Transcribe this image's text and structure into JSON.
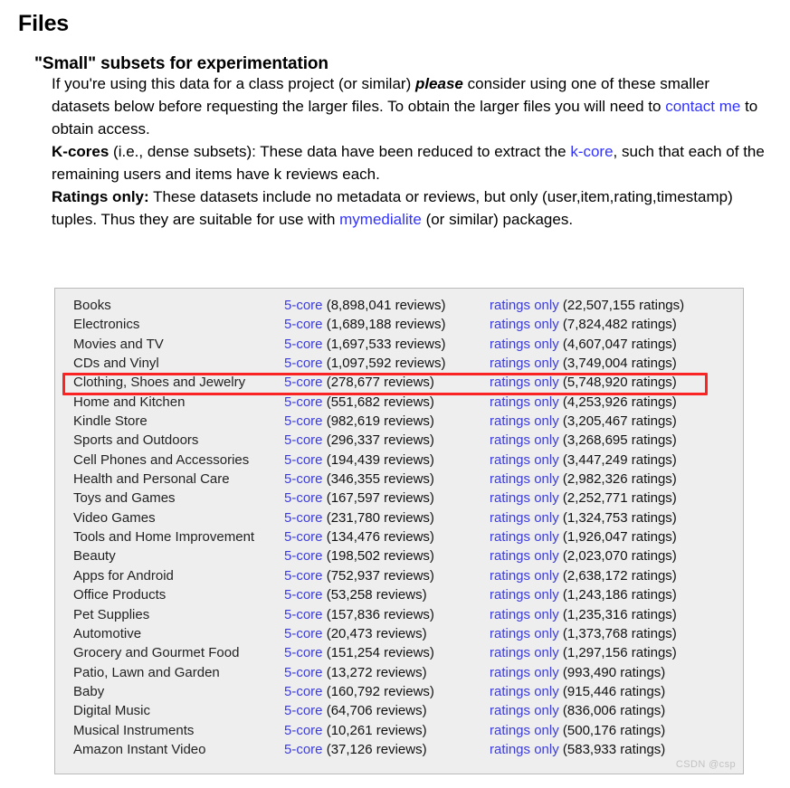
{
  "page": {
    "title": "Files",
    "subtitle": "\"Small\" subsets for experimentation",
    "watermark": "CSDN @csp"
  },
  "paragraphs": {
    "intro": {
      "part1": "If you're using this data for a class project (or similar) ",
      "emphasis": "please",
      "part2": " consider using one of these smaller datasets below before requesting the larger files. To obtain the larger files you will need to ",
      "link": "contact me",
      "part3": " to obtain access."
    },
    "kcores": {
      "lead": "K-cores",
      "part1": " (i.e., dense subsets): These data have been reduced to extract the ",
      "link": "k-core",
      "part2": ", such that each of the remaining users and items have k reviews each."
    },
    "ratings": {
      "lead": "Ratings only:",
      "part1": " These datasets include no metadata or reviews, but only (user,item,rating,timestamp) tuples. Thus they are suitable for use with ",
      "link": "mymedialite",
      "part2": " (or similar) packages."
    }
  },
  "table": {
    "core_link_label": "5-core",
    "ratings_link_label": "ratings only",
    "highlighted_row_index": 4,
    "rows": [
      {
        "name": "Books",
        "core_link": "5-core",
        "core_count": "(8,898,041 reviews)",
        "ratings_link": "ratings only",
        "ratings_count": "(22,507,155 ratings)"
      },
      {
        "name": "Electronics",
        "core_link": "5-core",
        "core_count": "(1,689,188 reviews)",
        "ratings_link": "ratings only",
        "ratings_count": "(7,824,482 ratings)"
      },
      {
        "name": "Movies and TV",
        "core_link": "5-core",
        "core_count": "(1,697,533 reviews)",
        "ratings_link": "ratings only",
        "ratings_count": "(4,607,047 ratings)"
      },
      {
        "name": "CDs and Vinyl",
        "core_link": "5-core",
        "core_count": "(1,097,592 reviews)",
        "ratings_link": "ratings only",
        "ratings_count": "(3,749,004 ratings)"
      },
      {
        "name": "Clothing, Shoes and Jewelry",
        "core_link": "5-core",
        "core_count": "(278,677 reviews)",
        "ratings_link": "ratings only",
        "ratings_count": "(5,748,920 ratings)"
      },
      {
        "name": "Home and Kitchen",
        "core_link": "5-core",
        "core_count": "(551,682 reviews)",
        "ratings_link": "ratings only",
        "ratings_count": "(4,253,926 ratings)"
      },
      {
        "name": "Kindle Store",
        "core_link": "5-core",
        "core_count": "(982,619 reviews)",
        "ratings_link": "ratings only",
        "ratings_count": "(3,205,467 ratings)"
      },
      {
        "name": "Sports and Outdoors",
        "core_link": "5-core",
        "core_count": "(296,337 reviews)",
        "ratings_link": "ratings only",
        "ratings_count": "(3,268,695 ratings)"
      },
      {
        "name": "Cell Phones and Accessories",
        "core_link": "5-core",
        "core_count": "(194,439 reviews)",
        "ratings_link": "ratings only",
        "ratings_count": "(3,447,249 ratings)"
      },
      {
        "name": "Health and Personal Care",
        "core_link": "5-core",
        "core_count": "(346,355 reviews)",
        "ratings_link": "ratings only",
        "ratings_count": "(2,982,326 ratings)"
      },
      {
        "name": "Toys and Games",
        "core_link": "5-core",
        "core_count": "(167,597 reviews)",
        "ratings_link": "ratings only",
        "ratings_count": "(2,252,771 ratings)"
      },
      {
        "name": "Video Games",
        "core_link": "5-core",
        "core_count": "(231,780 reviews)",
        "ratings_link": "ratings only",
        "ratings_count": "(1,324,753 ratings)"
      },
      {
        "name": "Tools and Home Improvement",
        "core_link": "5-core",
        "core_count": "(134,476 reviews)",
        "ratings_link": "ratings only",
        "ratings_count": "(1,926,047 ratings)"
      },
      {
        "name": "Beauty",
        "core_link": "5-core",
        "core_count": "(198,502 reviews)",
        "ratings_link": "ratings only",
        "ratings_count": "(2,023,070 ratings)"
      },
      {
        "name": "Apps for Android",
        "core_link": "5-core",
        "core_count": "(752,937 reviews)",
        "ratings_link": "ratings only",
        "ratings_count": "(2,638,172 ratings)"
      },
      {
        "name": "Office Products",
        "core_link": "5-core",
        "core_count": "(53,258 reviews)",
        "ratings_link": "ratings only",
        "ratings_count": "(1,243,186 ratings)"
      },
      {
        "name": "Pet Supplies",
        "core_link": "5-core",
        "core_count": "(157,836 reviews)",
        "ratings_link": "ratings only",
        "ratings_count": "(1,235,316 ratings)"
      },
      {
        "name": "Automotive",
        "core_link": "5-core",
        "core_count": "(20,473 reviews)",
        "ratings_link": "ratings only",
        "ratings_count": "(1,373,768 ratings)"
      },
      {
        "name": "Grocery and Gourmet Food",
        "core_link": "5-core",
        "core_count": "(151,254 reviews)",
        "ratings_link": "ratings only",
        "ratings_count": "(1,297,156 ratings)"
      },
      {
        "name": "Patio, Lawn and Garden",
        "core_link": "5-core",
        "core_count": "(13,272 reviews)",
        "ratings_link": "ratings only",
        "ratings_count": "(993,490 ratings)"
      },
      {
        "name": "Baby",
        "core_link": "5-core",
        "core_count": "(160,792 reviews)",
        "ratings_link": "ratings only",
        "ratings_count": "(915,446 ratings)"
      },
      {
        "name": "Digital Music",
        "core_link": "5-core",
        "core_count": "(64,706 reviews)",
        "ratings_link": "ratings only",
        "ratings_count": "(836,006 ratings)"
      },
      {
        "name": "Musical Instruments",
        "core_link": "5-core",
        "core_count": "(10,261 reviews)",
        "ratings_link": "ratings only",
        "ratings_count": "(500,176 ratings)"
      },
      {
        "name": "Amazon Instant Video",
        "core_link": "5-core",
        "core_count": "(37,126 reviews)",
        "ratings_link": "ratings only",
        "ratings_count": "(583,933 ratings)"
      }
    ]
  },
  "colors": {
    "link": "#3333ff",
    "table_link": "#3c3cdd",
    "panel_bg": "#eeeeee",
    "panel_border": "#b9b9b9",
    "highlight": "#fa2424"
  }
}
